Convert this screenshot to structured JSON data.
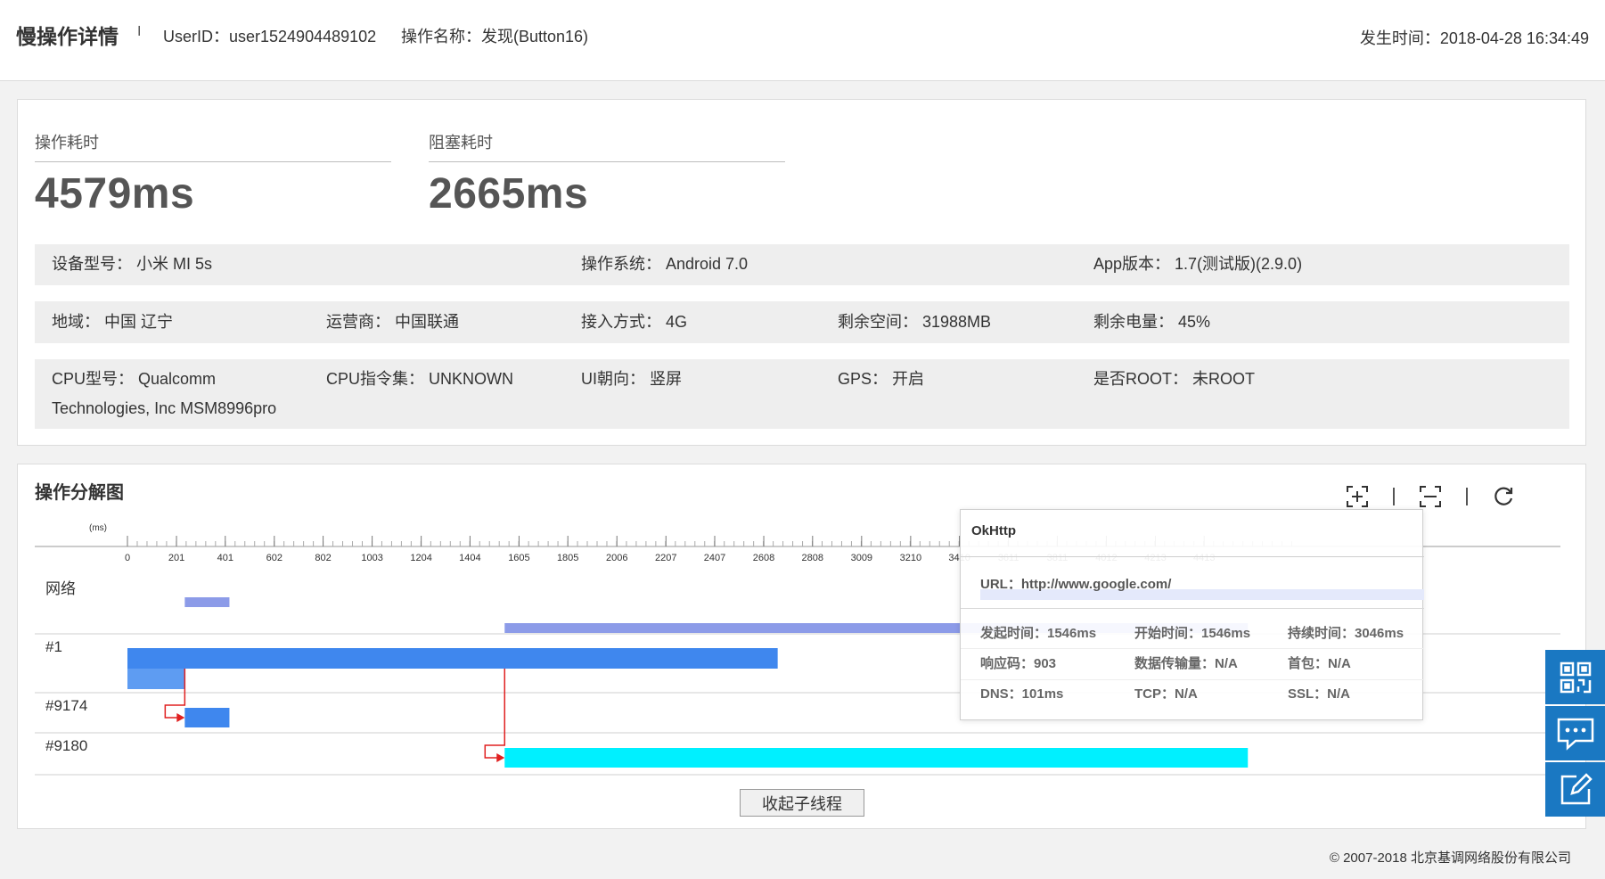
{
  "header": {
    "title": "慢操作详情",
    "separator": "I",
    "user_id": "UserID：user1524904489102",
    "operation_name": "操作名称：发现(Button16)",
    "occurred_time": "发生时间：2018-04-28 16:34:49"
  },
  "metrics": {
    "operation_time_label": "操作耗时",
    "operation_time_value": "4579ms",
    "block_time_label": "阻塞耗时",
    "block_time_value": "2665ms"
  },
  "device_info": {
    "row1": [
      "设备型号： 小米 MI 5s",
      "操作系统： Android 7.0",
      "App版本： 1.7(测试版)(2.9.0)"
    ],
    "row2": [
      "地域： 中国 辽宁",
      "运营商： 中国联通",
      "接入方式： 4G",
      "剩余空间： 31988MB",
      "剩余电量： 45%"
    ],
    "row3": [
      "CPU型号： Qualcomm",
      "Technologies, Inc MSM8996pro",
      "CPU指令集： UNKNOWN",
      "UI朝向： 竖屏",
      "GPS： 开启",
      "是否ROOT： 未ROOT"
    ]
  },
  "breakdown": {
    "title": "操作分解图",
    "axis_unit": "(ms)",
    "ticks": [
      "0",
      "201",
      "401",
      "602",
      "802",
      "1003",
      "1204",
      "1404",
      "1605",
      "1805",
      "2006",
      "2207",
      "2407",
      "2608",
      "2808",
      "3009",
      "3210",
      "3410",
      "3611",
      "3811",
      "4012",
      "4213",
      "4413"
    ],
    "tick_values": [
      0,
      201,
      401,
      602,
      802,
      1003,
      1204,
      1404,
      1605,
      1805,
      2006,
      2207,
      2407,
      2608,
      2808,
      3009,
      3210,
      3410,
      3611,
      3811,
      4012,
      4213,
      4413
    ],
    "rows": [
      "网络",
      "#1",
      "#9174",
      "#9180"
    ],
    "collapse_button": "收起子线程",
    "colors": {
      "network": "#8c9be8",
      "main_thread": "#3f87ee",
      "main_thread_light": "#5e9cf2",
      "thread_9174": "#3f87ee",
      "thread_9180": "#00f0ff",
      "link_arrow": "#e02020"
    },
    "toolbar_icons": [
      "zoom-in-icon",
      "zoom-out-icon",
      "refresh-icon"
    ]
  },
  "chart_data": {
    "type": "gantt",
    "x_unit": "ms",
    "xlim": [
      0,
      4579
    ],
    "rows": [
      {
        "name": "网络",
        "spans": [
          {
            "start": 235,
            "end": 418
          },
          {
            "start": 1546,
            "end": 4592
          }
        ]
      },
      {
        "name": "#1",
        "spans": [
          {
            "start": 0,
            "end": 2665,
            "level": 0
          },
          {
            "start": 0,
            "end": 235,
            "level": 1
          }
        ]
      },
      {
        "name": "#9174",
        "spans": [
          {
            "start": 235,
            "end": 418
          }
        ]
      },
      {
        "name": "#9180",
        "spans": [
          {
            "start": 1546,
            "end": 4592
          }
        ]
      }
    ],
    "links": [
      {
        "from_row": "#1",
        "to_row": "#9174",
        "at": 235
      },
      {
        "from_row": "#1",
        "to_row": "#9180",
        "at": 1546
      }
    ]
  },
  "tooltip": {
    "title": "OkHttp",
    "url": "URL：http://www.google.com/",
    "stats": [
      [
        "发起时间：1546ms",
        "开始时间：1546ms",
        "持续时间：3046ms"
      ],
      [
        "响应码：903",
        "数据传输量：N/A",
        "首包：N/A"
      ],
      [
        "DNS：101ms",
        "TCP：N/A",
        "SSL：N/A"
      ]
    ]
  },
  "side_buttons": [
    "qr-code-icon",
    "chat-icon",
    "edit-icon"
  ],
  "footer": "© 2007-2018 北京基调网络股份有限公司"
}
